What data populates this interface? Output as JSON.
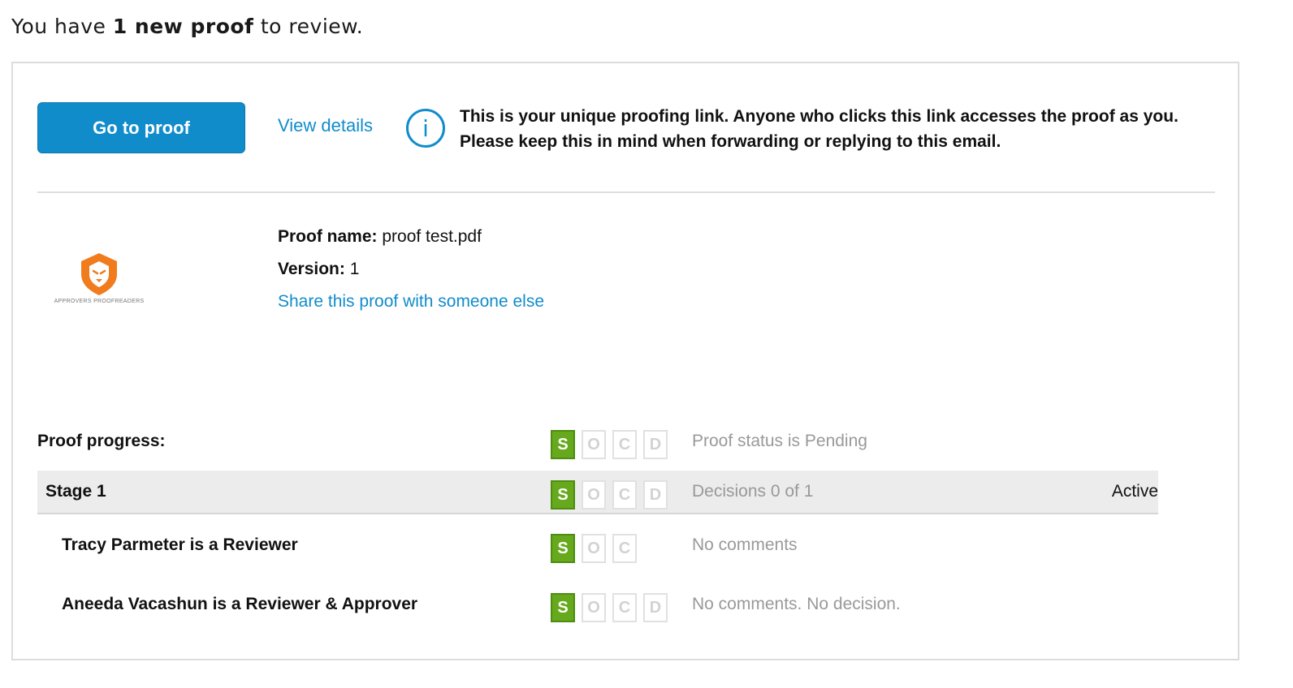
{
  "intro": {
    "prefix": "You have ",
    "bold": "1 new proof",
    "suffix": " to review."
  },
  "actions": {
    "go_to_proof": "Go to proof",
    "view_details": "View details",
    "info_icon_glyph": "i",
    "notice_line1": "This is your unique proofing link. Anyone who clicks this link accesses the proof as you.",
    "notice_line2": "Please keep this in mind when forwarding or replying to this email."
  },
  "proof": {
    "logo_caption": "APPROVERS PROOFREADERS",
    "name_label": "Proof name:",
    "name_value": " proof test.pdf",
    "version_label": "Version:",
    "version_value": " 1",
    "share_link": "Share this proof with someone else"
  },
  "progress": {
    "label": "Proof progress:",
    "boxes": [
      "S",
      "O",
      "C",
      "D"
    ],
    "status": "Proof status is Pending"
  },
  "stage": {
    "label": "Stage 1",
    "boxes": [
      "S",
      "O",
      "C",
      "D"
    ],
    "status": "Decisions 0 of 1",
    "state": "Active"
  },
  "participants": [
    {
      "name": "Tracy Parmeter is a Reviewer",
      "boxes": [
        "S",
        "O",
        "C"
      ],
      "status": "No comments"
    },
    {
      "name": "Aneeda Vacashun is a Reviewer & Approver",
      "boxes": [
        "S",
        "O",
        "C",
        "D"
      ],
      "status": "No comments. No decision."
    }
  ],
  "colors": {
    "brand_blue": "#118ccb",
    "stage_active_green": "#66a91d",
    "logo_orange": "#f07c1e"
  },
  "icons": {
    "info": "info-circle-icon",
    "logo": "lion-shield-logo"
  }
}
